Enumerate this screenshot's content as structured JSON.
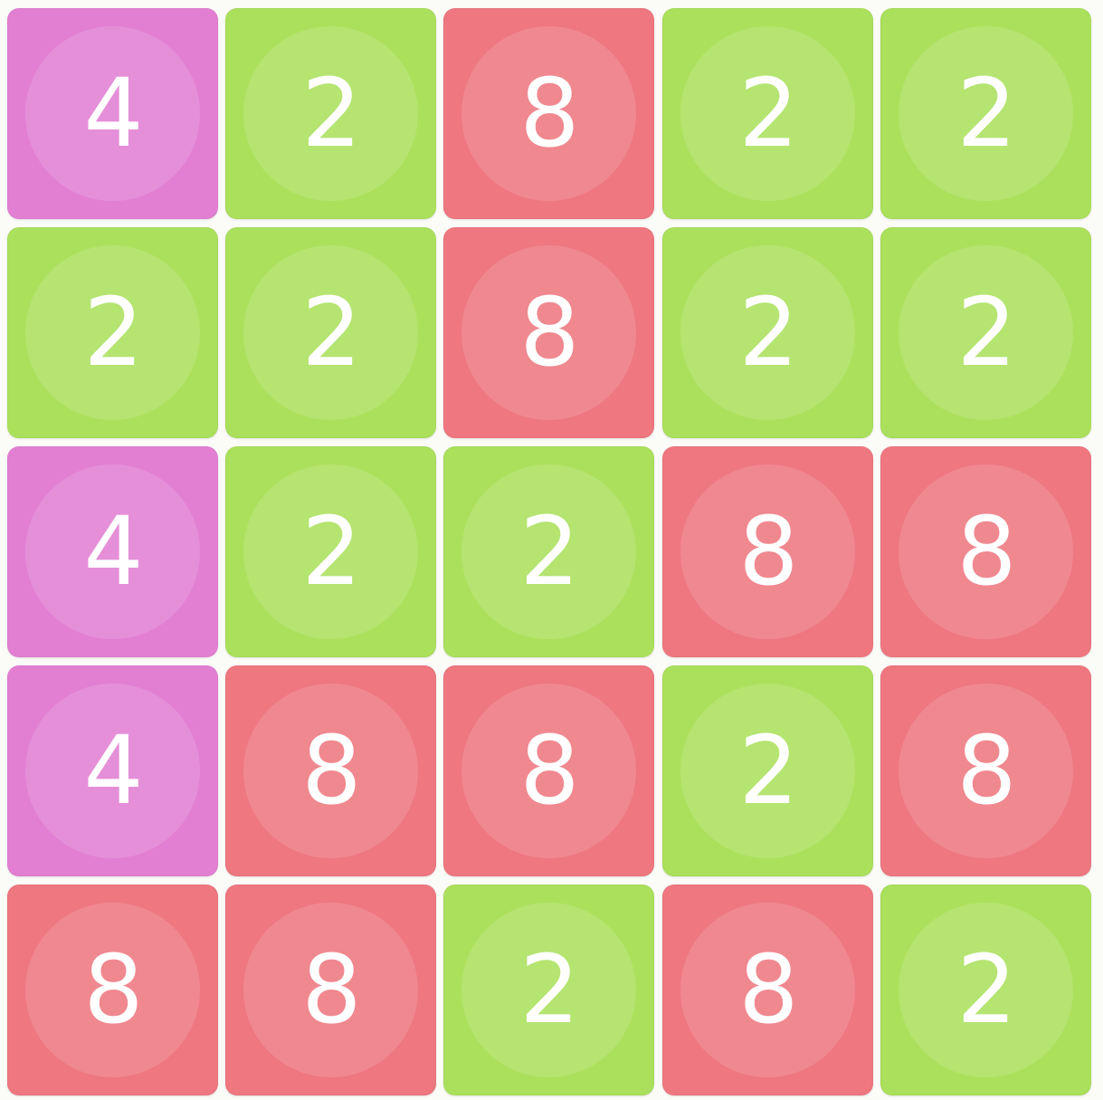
{
  "board": {
    "rows": [
      [
        "4",
        "2",
        "8",
        "2",
        "2"
      ],
      [
        "2",
        "2",
        "8",
        "2",
        "2"
      ],
      [
        "4",
        "2",
        "2",
        "8",
        "8"
      ],
      [
        "4",
        "8",
        "8",
        "2",
        "8"
      ],
      [
        "8",
        "8",
        "2",
        "8",
        "2"
      ]
    ]
  },
  "tile_colors": {
    "2": "#abe05c",
    "4": "#e27fd3",
    "8": "#ee7780"
  },
  "tile_icon": "pinwheel-icon"
}
